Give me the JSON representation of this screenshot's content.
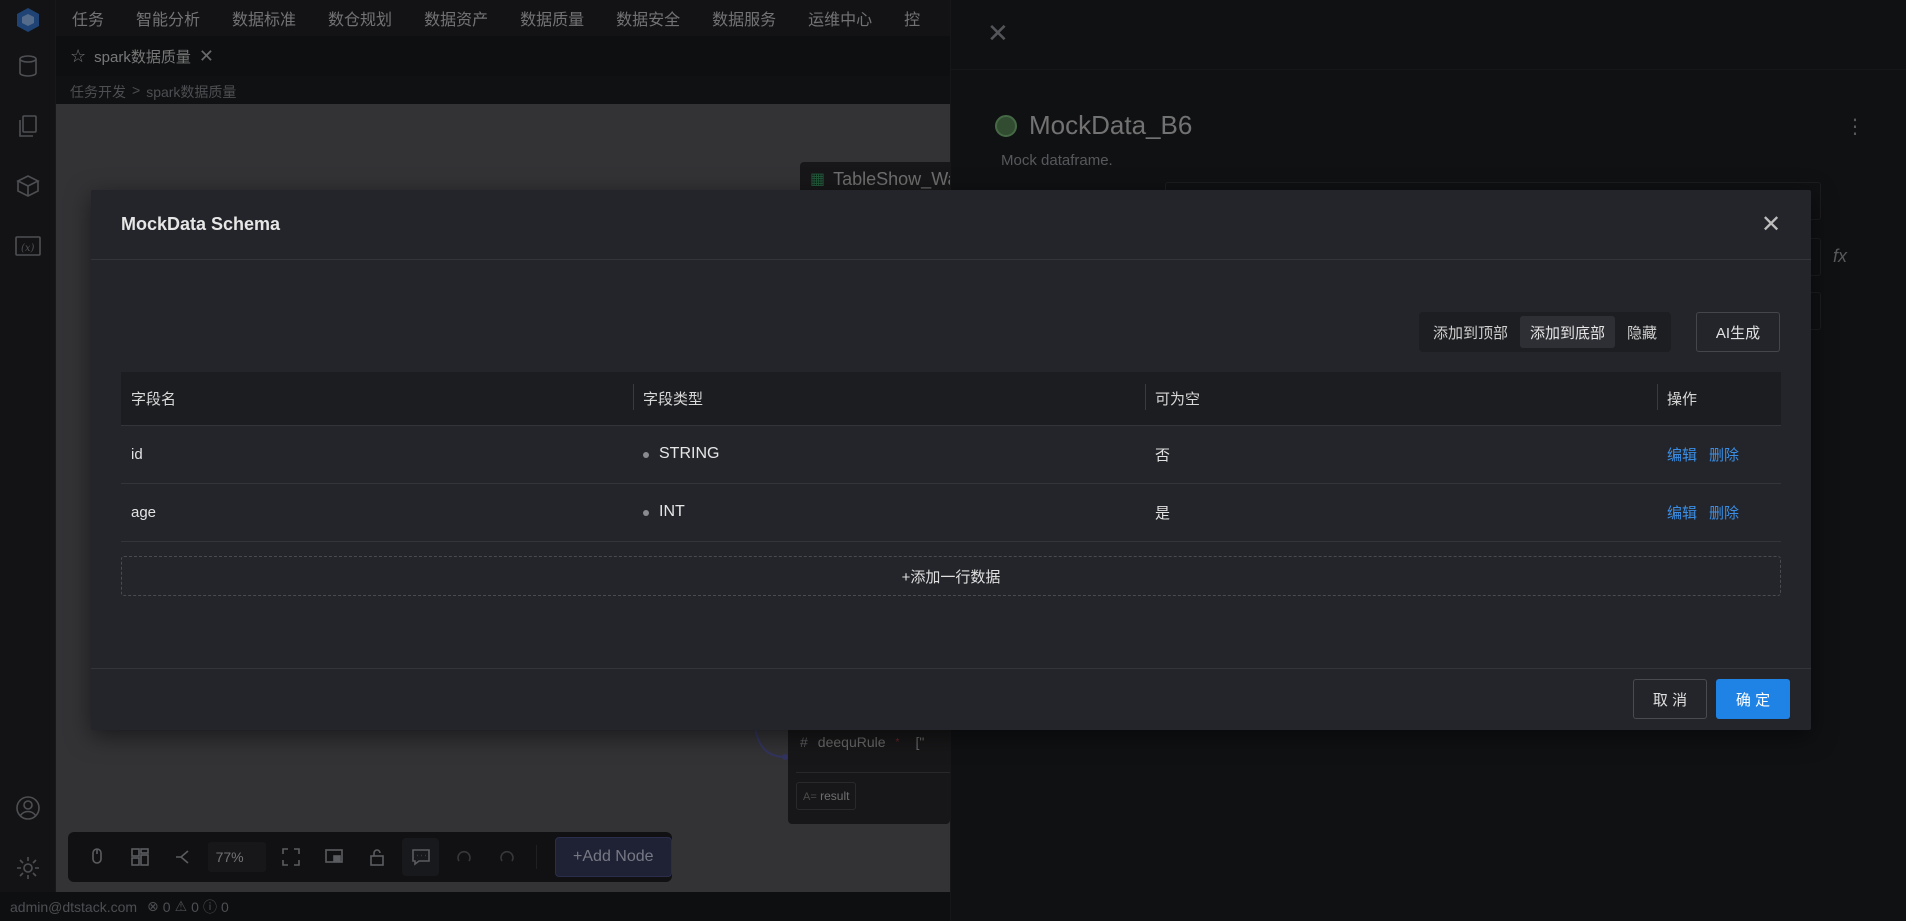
{
  "topnav": {
    "items": [
      "任务",
      "智能分析",
      "数据标准",
      "数仓规划",
      "数据资产",
      "数据质量",
      "数据安全",
      "数据服务",
      "运维中心",
      "控"
    ]
  },
  "tab": {
    "label": "spark数据质量"
  },
  "breadcrumb": {
    "parent": "任务开发",
    "current": "spark数据质量",
    "separator": ">"
  },
  "canvas": {
    "node_title": "TableShow_Wa",
    "field_name": "deequRule",
    "field_extra": "[\"",
    "result_tag": "result",
    "result_prefix": "A="
  },
  "toolbar": {
    "zoom": "77%",
    "add_node": "+Add Node"
  },
  "statusbar": {
    "user": "admin@dtstack.com",
    "errors": "0",
    "warnings": "0",
    "infos": "0"
  },
  "drawer": {
    "title": "MockData_B6",
    "description": "Mock dataframe.",
    "fx": "fx"
  },
  "modal": {
    "title": "MockData Schema",
    "segment": {
      "options": [
        "添加到顶部",
        "添加到底部",
        "隐藏"
      ],
      "active_index": 1
    },
    "ai_button": "AI生成",
    "table": {
      "headers": [
        "字段名",
        "字段类型",
        "可为空",
        "操作"
      ],
      "rows": [
        {
          "name": "id",
          "type": "STRING",
          "nullable": "否"
        },
        {
          "name": "age",
          "type": "INT",
          "nullable": "是"
        }
      ],
      "actions": {
        "edit": "编辑",
        "delete": "删除"
      }
    },
    "add_row": "+添加一行数据",
    "cancel": "取 消",
    "ok": "确 定"
  },
  "colors": {
    "primary": "#1f83e6",
    "link": "#3a8ee6",
    "add_node_bg": "#3a3e60"
  }
}
